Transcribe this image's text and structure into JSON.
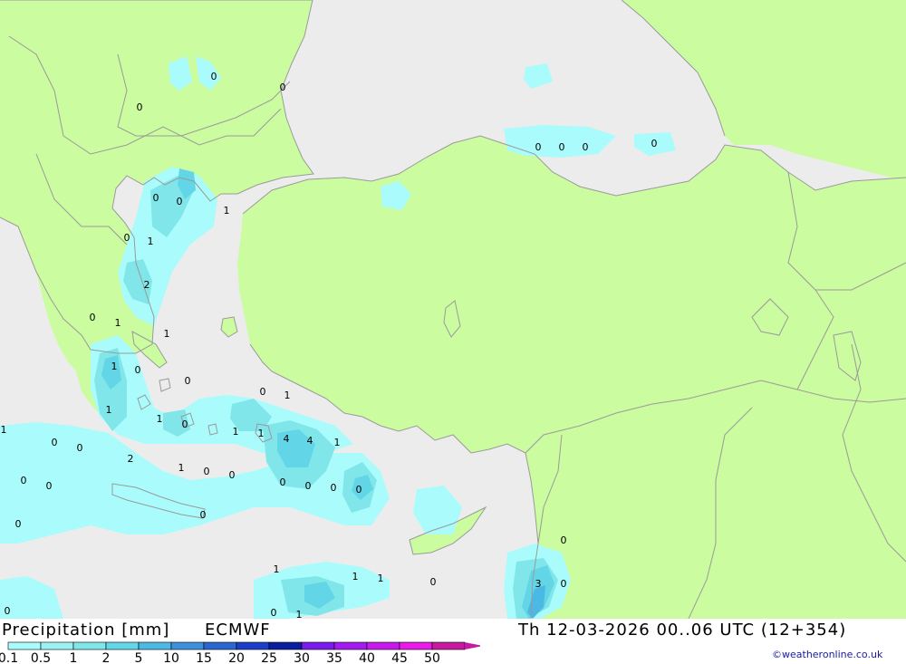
{
  "title": "Precipitation [mm]",
  "model": "ECMWF",
  "valid_time": "Th 12-03-2026 00..06 UTC (12+354)",
  "credit": "©weatheronline.co.uk",
  "colors": {
    "sea": "#ececec",
    "land": "#ccfca0",
    "border": "#9a9a9a"
  },
  "legend": {
    "labels": [
      "0.1",
      "0.5",
      "1",
      "2",
      "5",
      "10",
      "15",
      "20",
      "25",
      "30",
      "35",
      "40",
      "45",
      "50"
    ],
    "colors": [
      "#aafcfc",
      "#9cf2f2",
      "#80e6ea",
      "#62d6e6",
      "#4cb8e4",
      "#3c90de",
      "#2a66d2",
      "#1a3ec8",
      "#0a1ea0",
      "#7a1aec",
      "#a21af0",
      "#c81aec",
      "#ea1aea",
      "#c81aa0"
    ]
  },
  "map_values": [
    "0",
    "0",
    "0",
    "0",
    "0",
    "0",
    "0",
    "0",
    "0",
    "1",
    "0",
    "1",
    "2",
    "0",
    "1",
    "1",
    "1",
    "0",
    "0",
    "1",
    "0",
    "1",
    "1",
    "0",
    "1",
    "1",
    "4",
    "4",
    "1",
    "1",
    "0",
    "0",
    "2",
    "1",
    "0",
    "0",
    "0",
    "0",
    "0",
    "0",
    "0",
    "0",
    "0",
    "0",
    "0",
    "1",
    "1",
    "1",
    "0",
    "3",
    "0",
    "0",
    "0",
    "1"
  ]
}
